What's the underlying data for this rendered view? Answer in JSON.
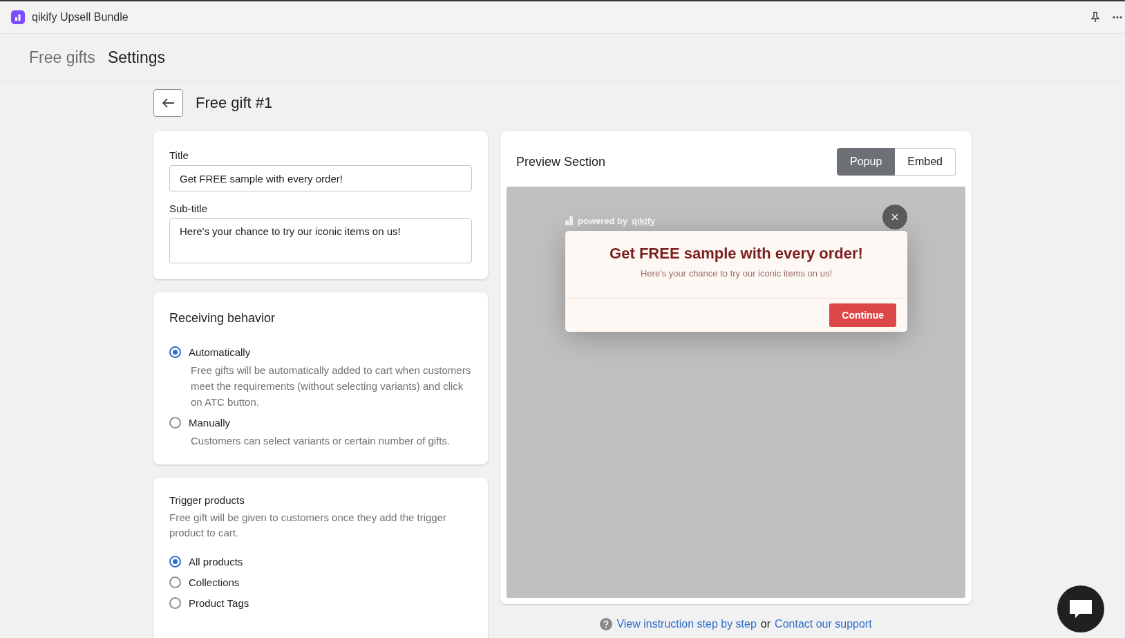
{
  "app": {
    "name": "qikify Upsell Bundle"
  },
  "nav": [
    {
      "label": "Free gifts",
      "selected": false
    },
    {
      "label": "Settings",
      "selected": true
    }
  ],
  "page_title": "Free gift #1",
  "text_card": {
    "fields": [
      {
        "label": "Title",
        "value": "Get FREE sample with every order!",
        "kind": "input"
      },
      {
        "label": "Sub-title",
        "value": "Here's your chance to try our iconic items on us!",
        "kind": "textarea"
      }
    ]
  },
  "receiving": {
    "heading": "Receiving behavior",
    "options": [
      {
        "label": "Automatically",
        "description": "Free gifts will be automatically added to cart when customers meet the requirements (without selecting variants) and click on ATC button.",
        "selected": true
      },
      {
        "label": "Manually",
        "description": "Customers can select variants or certain number of gifts.",
        "selected": false
      }
    ]
  },
  "trigger": {
    "heading": "Trigger products",
    "description": "Free gift will be given to customers once they add the trigger product to cart.",
    "options": [
      {
        "label": "All products",
        "selected": true
      },
      {
        "label": "Collections",
        "selected": false
      },
      {
        "label": "Product Tags",
        "selected": false
      }
    ]
  },
  "preview": {
    "heading": "Preview Section",
    "modes": [
      {
        "label": "Popup",
        "selected": true
      },
      {
        "label": "Embed",
        "selected": false
      }
    ],
    "popup": {
      "powered_by": "powered by",
      "brand": "qikify",
      "title": "Get FREE sample with every order!",
      "subtitle": "Here's your chance to try our iconic items on us!",
      "button": "Continue"
    }
  },
  "footer": {
    "instruction_link": "View instruction step by step",
    "connector": "or",
    "support_link": "Contact our support"
  }
}
